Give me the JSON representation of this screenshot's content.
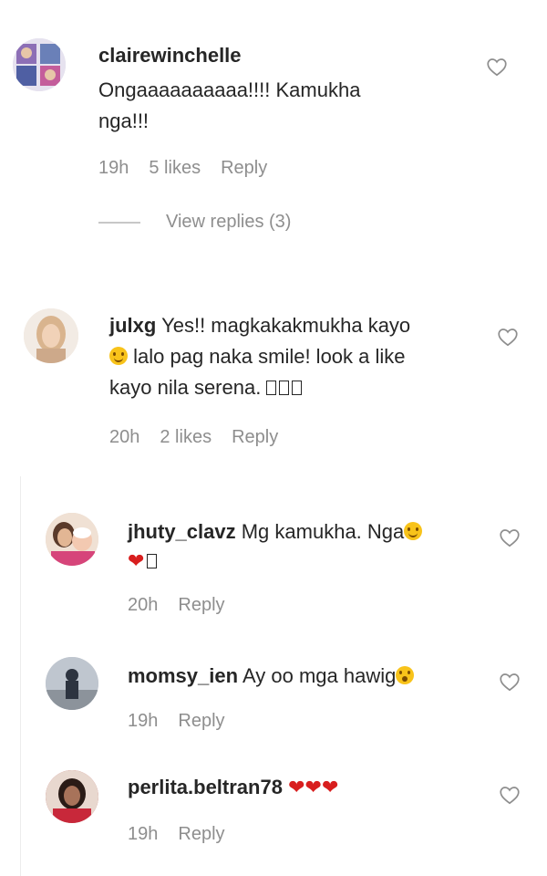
{
  "comments": [
    {
      "username": "clairewinchelle",
      "line1": "Ongaaaaaaaaaa!!!! Kamukha",
      "line2": "nga!!!",
      "time": "19h",
      "likes": "5 likes",
      "reply": "Reply"
    },
    {
      "username": "julxg",
      "line1": "Yes!! magkakakmukha kayo",
      "line2": "lalo pag naka smile! look a like",
      "line3": "kayo nila serena.",
      "time": "20h",
      "likes": "2 likes",
      "reply": "Reply"
    }
  ],
  "view_replies": "View replies (3)",
  "replies": [
    {
      "username": "jhuty_clavz",
      "text": "Mg kamukha. Nga",
      "time": "20h",
      "reply": "Reply"
    },
    {
      "username": "momsy_ien",
      "text": "Ay oo mga hawig",
      "time": "19h",
      "reply": "Reply"
    },
    {
      "username": "perlita.beltran78",
      "time": "19h",
      "reply": "Reply"
    }
  ],
  "icons": {
    "like": "heart-outline-icon",
    "emoji_smile": "smiling-face-emoji",
    "emoji_wow": "astonished-face-emoji",
    "red_heart": "red-heart-emoji"
  },
  "colors": {
    "text": "#262626",
    "meta": "#8e8e8e",
    "red_heart": "#d81e1e",
    "emoji": "#f8c31a"
  }
}
